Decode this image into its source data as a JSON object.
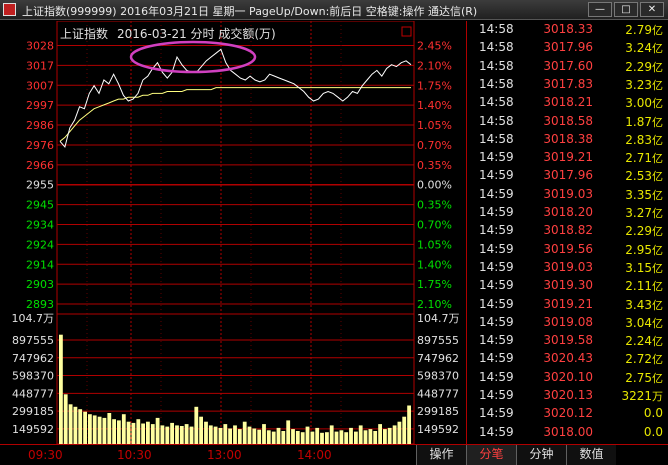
{
  "window": {
    "title": "上证指数(999999) 2016年03月21日 星期一 PageUp/Down:前后日 空格键:操作 通达信(R)",
    "min_label": "—",
    "max_label": "□",
    "close_label": "✕"
  },
  "chart": {
    "header_name": "上证指数",
    "header_info": "2016-03-21 分时 成交额(万)",
    "price_ticks": [
      "3028",
      "3017",
      "3007",
      "2997",
      "2986",
      "2976",
      "2966",
      "2955",
      "2945",
      "2934",
      "2924",
      "2914",
      "2903",
      "2893"
    ],
    "pct_ticks": [
      "2.45%",
      "2.10%",
      "1.75%",
      "1.40%",
      "1.05%",
      "0.70%",
      "0.35%",
      "0.00%",
      "0.35%",
      "0.70%",
      "1.05%",
      "1.40%",
      "1.75%",
      "2.10%"
    ],
    "volume_header": "104.7万",
    "volume_ticks": [
      "897555",
      "747962",
      "598370",
      "448777",
      "299185",
      "149592"
    ],
    "time_labels": [
      "09:30",
      "10:30",
      "13:00",
      "14:00"
    ],
    "colors": {
      "up": "#ff3030",
      "down": "#00e000",
      "flat": "#e0e0e0",
      "grid": "#b00000",
      "price_line": "#ffffff",
      "avg_line": "#ffff80",
      "volume": "#ffffa0",
      "highlight_ellipse": "#d040c0"
    }
  },
  "chart_data": {
    "type": "line",
    "x_range": [
      "09:30",
      "15:00"
    ],
    "ylim": [
      2893,
      3028
    ],
    "series": [
      {
        "values": [
          2978,
          2975,
          2985,
          2989,
          2996,
          2995,
          3003,
          3007,
          3003,
          3010,
          3008,
          3013,
          3008,
          3002,
          2999,
          3000,
          3003,
          3010,
          3012,
          3016,
          3019,
          3014,
          3011,
          3014,
          3022,
          3018,
          3015,
          3014,
          3014,
          3017,
          3020,
          3022,
          3024,
          3026,
          3019,
          3015,
          3013,
          3011,
          3010,
          3012,
          3010,
          3009,
          3010,
          3013,
          3012,
          3011,
          3010,
          3009,
          3008,
          3006,
          3004,
          3001,
          2999,
          3000,
          3003,
          3004,
          3003,
          3001,
          2999,
          3001,
          3004,
          3003,
          3007,
          3010,
          3013,
          3015,
          3012,
          3016,
          3018,
          3017,
          3019,
          3020,
          3018
        ]
      },
      {
        "values": [
          2978,
          2980,
          2983,
          2986,
          2989,
          2991,
          2993,
          2995,
          2996,
          2997,
          2998,
          2999,
          3000,
          3000,
          3001,
          3001,
          3001,
          3002,
          3002,
          3003,
          3003,
          3003,
          3004,
          3004,
          3004,
          3004,
          3005,
          3005,
          3005,
          3005,
          3005,
          3005,
          3006,
          3006,
          3006,
          3006,
          3006,
          3006,
          3006,
          3006,
          3006,
          3006,
          3006,
          3006,
          3006,
          3006,
          3006,
          3006,
          3006,
          3006,
          3006,
          3006,
          3006,
          3006,
          3006,
          3006,
          3006,
          3006,
          3006,
          3006,
          3006,
          3006,
          3006,
          3006,
          3006,
          3006,
          3006,
          3006,
          3006,
          3006,
          3006,
          3006,
          3006
        ]
      }
    ],
    "volume": {
      "ylim": [
        0,
        1047000
      ],
      "values": [
        880000,
        400000,
        320000,
        300000,
        280000,
        260000,
        240000,
        230000,
        220000,
        210000,
        250000,
        200000,
        190000,
        240000,
        180000,
        170000,
        200000,
        165000,
        180000,
        160000,
        210000,
        150000,
        140000,
        170000,
        150000,
        145000,
        160000,
        140000,
        300000,
        220000,
        180000,
        150000,
        140000,
        130000,
        160000,
        125000,
        150000,
        120000,
        180000,
        140000,
        125000,
        115000,
        160000,
        110000,
        100000,
        130000,
        105000,
        190000,
        120000,
        105000,
        95000,
        140000,
        100000,
        130000,
        90000,
        95000,
        150000,
        100000,
        110000,
        95000,
        130000,
        100000,
        150000,
        110000,
        120000,
        105000,
        160000,
        120000,
        130000,
        150000,
        180000,
        220000,
        310000
      ]
    }
  },
  "ticks": [
    {
      "time": "14:58",
      "price": "3018.33",
      "vol": "2.79",
      "unit": "亿",
      "dir": "up"
    },
    {
      "time": "14:58",
      "price": "3017.96",
      "vol": "3.24",
      "unit": "亿",
      "dir": "up"
    },
    {
      "time": "14:58",
      "price": "3017.60",
      "vol": "2.29",
      "unit": "亿",
      "dir": "up"
    },
    {
      "time": "14:58",
      "price": "3017.83",
      "vol": "3.23",
      "unit": "亿",
      "dir": "up"
    },
    {
      "time": "14:58",
      "price": "3018.21",
      "vol": "3.00",
      "unit": "亿",
      "dir": "up"
    },
    {
      "time": "14:58",
      "price": "3018.58",
      "vol": "1.87",
      "unit": "亿",
      "dir": "up"
    },
    {
      "time": "14:58",
      "price": "3018.38",
      "vol": "2.83",
      "unit": "亿",
      "dir": "up"
    },
    {
      "time": "14:59",
      "price": "3019.21",
      "vol": "2.71",
      "unit": "亿",
      "dir": "up"
    },
    {
      "time": "14:59",
      "price": "3017.96",
      "vol": "2.53",
      "unit": "亿",
      "dir": "up"
    },
    {
      "time": "14:59",
      "price": "3019.03",
      "vol": "3.35",
      "unit": "亿",
      "dir": "up"
    },
    {
      "time": "14:59",
      "price": "3018.20",
      "vol": "3.27",
      "unit": "亿",
      "dir": "up"
    },
    {
      "time": "14:59",
      "price": "3018.82",
      "vol": "2.29",
      "unit": "亿",
      "dir": "up"
    },
    {
      "time": "14:59",
      "price": "3019.56",
      "vol": "2.95",
      "unit": "亿",
      "dir": "up"
    },
    {
      "time": "14:59",
      "price": "3019.03",
      "vol": "3.15",
      "unit": "亿",
      "dir": "up"
    },
    {
      "time": "14:59",
      "price": "3019.30",
      "vol": "2.11",
      "unit": "亿",
      "dir": "up"
    },
    {
      "time": "14:59",
      "price": "3019.21",
      "vol": "3.43",
      "unit": "亿",
      "dir": "up"
    },
    {
      "time": "14:59",
      "price": "3019.08",
      "vol": "3.04",
      "unit": "亿",
      "dir": "up"
    },
    {
      "time": "14:59",
      "price": "3019.58",
      "vol": "2.24",
      "unit": "亿",
      "dir": "up"
    },
    {
      "time": "14:59",
      "price": "3020.43",
      "vol": "2.72",
      "unit": "亿",
      "dir": "up"
    },
    {
      "time": "14:59",
      "price": "3020.10",
      "vol": "2.75",
      "unit": "亿",
      "dir": "up"
    },
    {
      "time": "14:59",
      "price": "3020.13",
      "vol": "3221",
      "unit": "万",
      "dir": "up"
    },
    {
      "time": "14:59",
      "price": "3020.12",
      "vol": "0.0",
      "unit": "",
      "dir": "up"
    },
    {
      "time": "14:59",
      "price": "3018.00",
      "vol": "0.0",
      "unit": "",
      "dir": "up"
    }
  ],
  "tabs": [
    {
      "label": "操作",
      "active": false
    },
    {
      "label": "分笔",
      "active": true
    },
    {
      "label": "分钟",
      "active": false
    },
    {
      "label": "数值",
      "active": false
    }
  ]
}
